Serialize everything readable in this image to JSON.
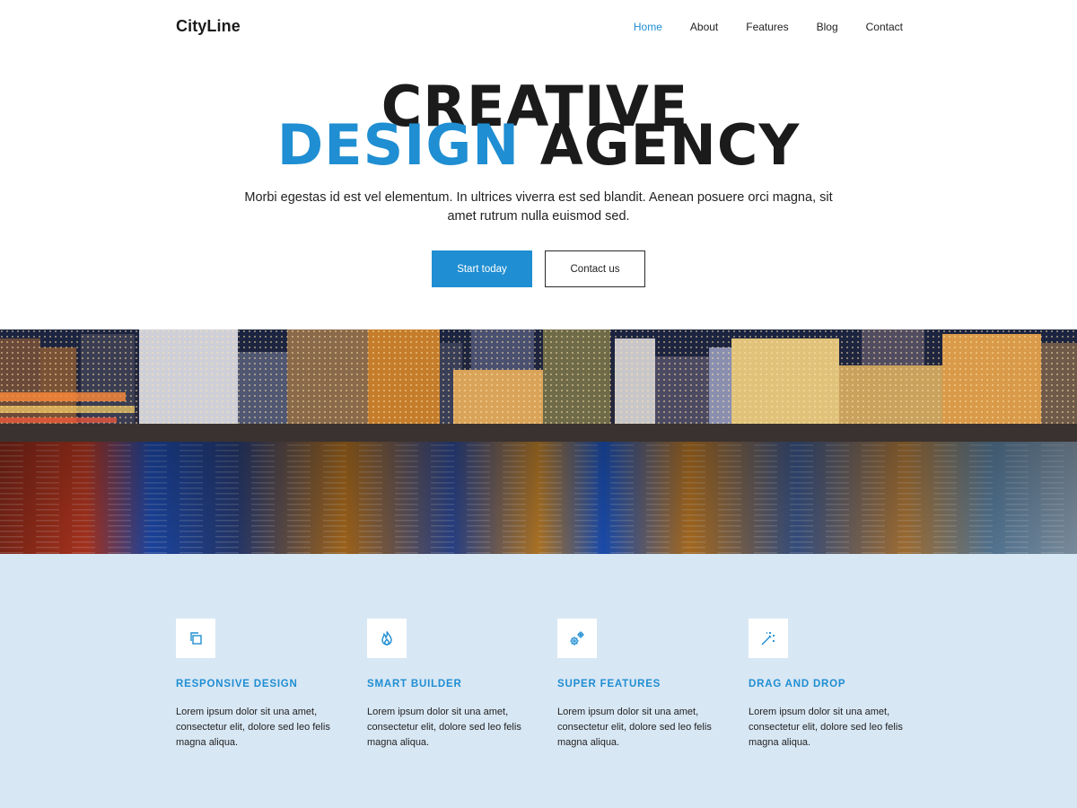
{
  "header": {
    "logo": "CityLine",
    "nav": [
      {
        "label": "Home",
        "active": true
      },
      {
        "label": "About",
        "active": false
      },
      {
        "label": "Features",
        "active": false
      },
      {
        "label": "Blog",
        "active": false
      },
      {
        "label": "Contact",
        "active": false
      }
    ]
  },
  "hero": {
    "line1": "CREATIVE",
    "line2_highlight": "DESIGN",
    "line2_rest": "AGENCY",
    "text": "Morbi egestas id est vel elementum. In ultrices viverra est sed blandit. Aenean posuere orci magna, sit amet rutrum nulla euismod sed.",
    "primary_button": "Start today",
    "secondary_button": "Contact us"
  },
  "banner": {
    "icon": "city-skyline-night-image"
  },
  "features": [
    {
      "icon": "copy-icon",
      "title": "RESPONSIVE DESIGN",
      "text": "Lorem ipsum dolor sit una amet, consectetur elit, dolore sed leo felis magna aliqua."
    },
    {
      "icon": "flame-icon",
      "title": "SMART BUILDER",
      "text": "Lorem ipsum dolor sit una amet, consectetur elit, dolore sed leo felis magna aliqua."
    },
    {
      "icon": "gears-icon",
      "title": "SUPER FEATURES",
      "text": "Lorem ipsum dolor sit una amet, consectetur elit, dolore sed leo felis magna aliqua."
    },
    {
      "icon": "magic-wand-icon",
      "title": "DRAG AND DROP",
      "text": "Lorem ipsum dolor sit una amet, consectetur elit, dolore sed leo felis magna aliqua."
    }
  ],
  "colors": {
    "accent": "#1f8ed2",
    "dark": "#1b1b1b",
    "features_bg": "#d8e7f4"
  }
}
